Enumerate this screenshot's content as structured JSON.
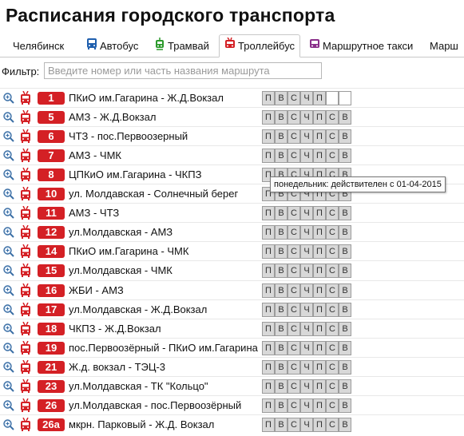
{
  "app": {
    "title": "Расписания городского транспорта"
  },
  "tabs": [
    {
      "label": "Челябинск",
      "icon": "none",
      "color": "#333333"
    },
    {
      "label": "Автобус",
      "icon": "bus-icon",
      "color": "#1f5fae"
    },
    {
      "label": "Трамвай",
      "icon": "tram-icon",
      "color": "#2c9a2c"
    },
    {
      "label": "Троллейбус",
      "icon": "trolleybus-icon",
      "color": "#d42025",
      "active": true
    },
    {
      "label": "Маршрутное такси",
      "icon": "minibus-icon",
      "color": "#8a2f8a"
    },
    {
      "label": "Марш",
      "icon": "none",
      "color": "#333333"
    }
  ],
  "filter": {
    "label": "Фильтр:",
    "placeholder": "Введите номер или часть названия маршрута"
  },
  "tooltip": {
    "text": "понедельник: действителен с 01-04-2015"
  },
  "routes": [
    {
      "num": "1",
      "name": "ПКиО им.Гагарина - Ж.Д.Вокзал",
      "days": [
        "П",
        "В",
        "С",
        "Ч",
        "П",
        "",
        ""
      ]
    },
    {
      "num": "5",
      "name": "АМЗ - Ж.Д.Вокзал",
      "days": [
        "П",
        "В",
        "С",
        "Ч",
        "П",
        "С",
        "В"
      ]
    },
    {
      "num": "6",
      "name": "ЧТЗ - пос.Первоозерный",
      "days": [
        "П",
        "В",
        "С",
        "Ч",
        "П",
        "С",
        "В"
      ]
    },
    {
      "num": "7",
      "name": "АМЗ - ЧМК",
      "days": [
        "П",
        "В",
        "С",
        "Ч",
        "П",
        "С",
        "В"
      ]
    },
    {
      "num": "8",
      "name": "ЦПКиО им.Гагарина - ЧКПЗ",
      "days": [
        "П",
        "В",
        "С",
        "Ч",
        "П",
        "С",
        "В"
      ]
    },
    {
      "num": "10",
      "name": "ул. Молдавская - Солнечный берег",
      "days": [
        "П",
        "В",
        "С",
        "Ч",
        "П",
        "С",
        "В"
      ]
    },
    {
      "num": "11",
      "name": "АМЗ - ЧТЗ",
      "days": [
        "П",
        "В",
        "С",
        "Ч",
        "П",
        "С",
        "В"
      ]
    },
    {
      "num": "12",
      "name": "ул.Молдавская - АМЗ",
      "days": [
        "П",
        "В",
        "С",
        "Ч",
        "П",
        "С",
        "В"
      ]
    },
    {
      "num": "14",
      "name": "ПКиО им.Гагарина - ЧМК",
      "days": [
        "П",
        "В",
        "С",
        "Ч",
        "П",
        "С",
        "В"
      ]
    },
    {
      "num": "15",
      "name": "ул.Молдавская - ЧМК",
      "days": [
        "П",
        "В",
        "С",
        "Ч",
        "П",
        "С",
        "В"
      ]
    },
    {
      "num": "16",
      "name": "ЖБИ - АМЗ",
      "days": [
        "П",
        "В",
        "С",
        "Ч",
        "П",
        "С",
        "В"
      ]
    },
    {
      "num": "17",
      "name": "ул.Молдавская - Ж.Д.Вокзал",
      "days": [
        "П",
        "В",
        "С",
        "Ч",
        "П",
        "С",
        "В"
      ]
    },
    {
      "num": "18",
      "name": "ЧКПЗ - Ж.Д.Вокзал",
      "days": [
        "П",
        "В",
        "С",
        "Ч",
        "П",
        "С",
        "В"
      ]
    },
    {
      "num": "19",
      "name": "пос.Первоозёрный - ПКиО им.Гагарина",
      "days": [
        "П",
        "В",
        "С",
        "Ч",
        "П",
        "С",
        "В"
      ]
    },
    {
      "num": "21",
      "name": "Ж.д. вокзал - ТЭЦ-3",
      "days": [
        "П",
        "В",
        "С",
        "Ч",
        "П",
        "С",
        "В"
      ]
    },
    {
      "num": "23",
      "name": "ул.Молдавская - ТК \"Кольцо\"",
      "days": [
        "П",
        "В",
        "С",
        "Ч",
        "П",
        "С",
        "В"
      ]
    },
    {
      "num": "26",
      "name": "ул.Молдавская - пос.Первоозёрный",
      "days": [
        "П",
        "В",
        "С",
        "Ч",
        "П",
        "С",
        "В"
      ]
    },
    {
      "num": "26а",
      "name": "мкрн. Парковый - Ж.Д. Вокзал",
      "days": [
        "П",
        "В",
        "С",
        "Ч",
        "П",
        "С",
        "В"
      ]
    }
  ]
}
